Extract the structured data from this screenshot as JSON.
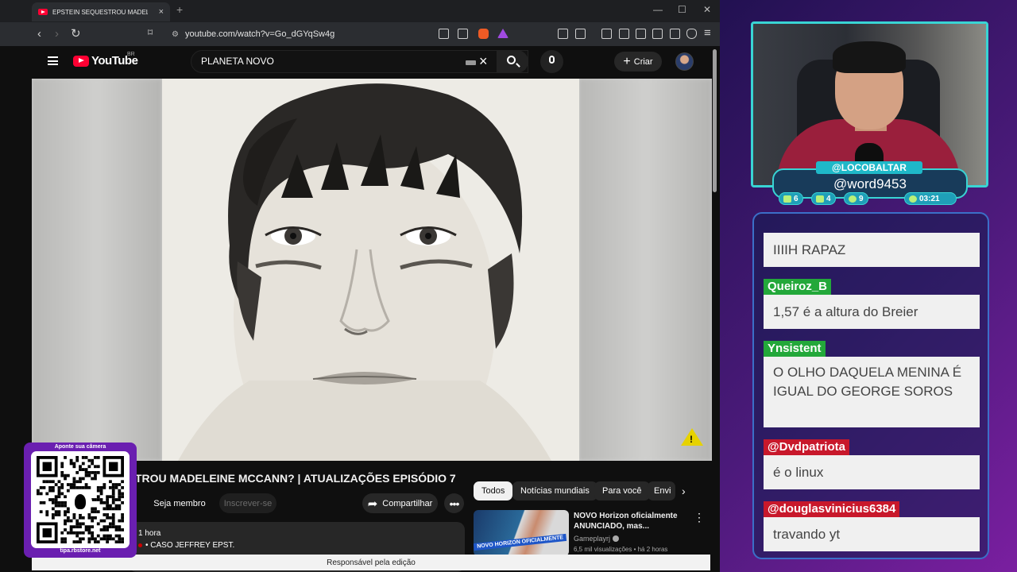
{
  "browser": {
    "tab_title": "EPSTEIN SEQUESTROU MADELEINE M...",
    "new_tab": "+",
    "url": "youtube.com/watch?v=Go_dGYqSw4g"
  },
  "youtube": {
    "logo_text": "YouTube",
    "logo_region": "BR",
    "search_value": "PLANETA NOVO",
    "create_label": "Criar",
    "video_title": "TROU MADELEINE MCCANN? | ATUALIZAÇÕES EPISÓDIO 7",
    "member_label": "Seja membro",
    "subscribe_label": "Inscrever-se",
    "share_label": "Compartilhar",
    "desc_time": "1 hora",
    "desc_tag": "• CASO JEFFREY EPST.",
    "chips": [
      "Todos",
      "Notícias mundiais",
      "Para você",
      "Envi"
    ],
    "rec": {
      "title": "NOVO Horizon oficialmente ANUNCIADO, mas...",
      "channel": "Gameplayrj",
      "meta": "6,5 mil visualizações • há 2 horas",
      "thumb_banner": "NOVO HORIZON OFICIALMENTE"
    },
    "status_text": "Responsável pela edição"
  },
  "qr": {
    "top_text": "Aponte sua câmera",
    "bottom_text": "tipa.rbstore.net"
  },
  "stream": {
    "channel_tag": "@LOCOBALTAR",
    "handle": "@word9453",
    "stats": {
      "chat": "6",
      "youtube": "4",
      "other": "9",
      "time": "03:21"
    }
  },
  "chat": [
    {
      "user": "",
      "message": "IIIIH RAPAZ",
      "color": "#c8182b"
    },
    {
      "user": "Queiroz_B",
      "message": "1,57 é a altura do Breier",
      "color": "#23a83a"
    },
    {
      "user": "Ynsistent",
      "message": "O OLHO DAQUELA MENINA É IGUAL DO GEORGE SOROS",
      "color": "#23a83a"
    },
    {
      "user": "@Dvdpatriota",
      "message": "é o linux",
      "color": "#c8182b"
    },
    {
      "user": "@douglasvinicius6384",
      "message": "travando yt",
      "color": "#c8182b"
    }
  ]
}
